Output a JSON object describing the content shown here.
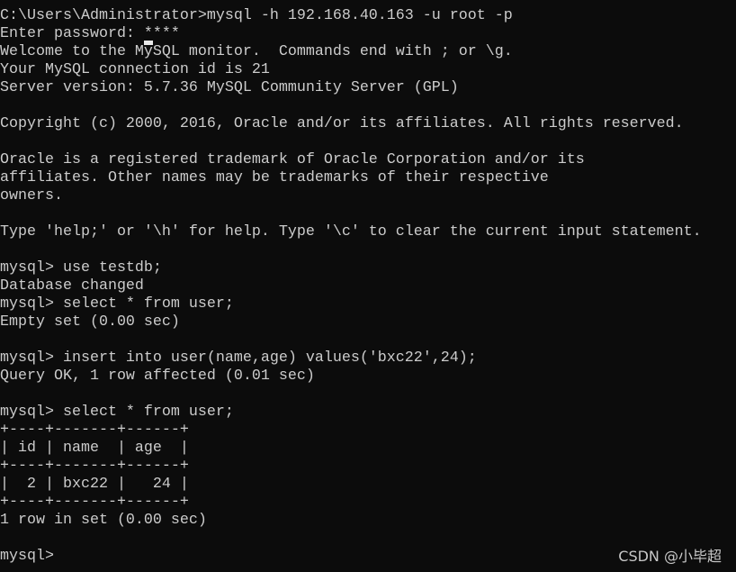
{
  "terminal": {
    "background": "#0c0c0c",
    "foreground": "#cccccc",
    "lines": [
      "C:\\Users\\Administrator>mysql -h 192.168.40.163 -u root -p",
      "Enter password: ****",
      "Welcome to the MySQL monitor.  Commands end with ; or \\g.",
      "Your MySQL connection id is 21",
      "Server version: 5.7.36 MySQL Community Server (GPL)",
      "",
      "Copyright (c) 2000, 2016, Oracle and/or its affiliates. All rights reserved.",
      "",
      "Oracle is a registered trademark of Oracle Corporation and/or its",
      "affiliates. Other names may be trademarks of their respective",
      "owners.",
      "",
      "Type 'help;' or '\\h' for help. Type '\\c' to clear the current input statement.",
      "",
      "mysql> use testdb;",
      "Database changed",
      "mysql> select * from user;",
      "Empty set (0.00 sec)",
      "",
      "mysql> insert into user(name,age) values('bxc22',24);",
      "Query OK, 1 row affected (0.01 sec)",
      "",
      "mysql> select * from user;",
      "+----+-------+------+",
      "| id | name  | age  |",
      "+----+-------+------+",
      "|  2 | bxc22 |   24 |",
      "+----+-------+------+",
      "1 row in set (0.00 sec)",
      "",
      "mysql>"
    ]
  },
  "watermark": "CSDN @小毕超"
}
